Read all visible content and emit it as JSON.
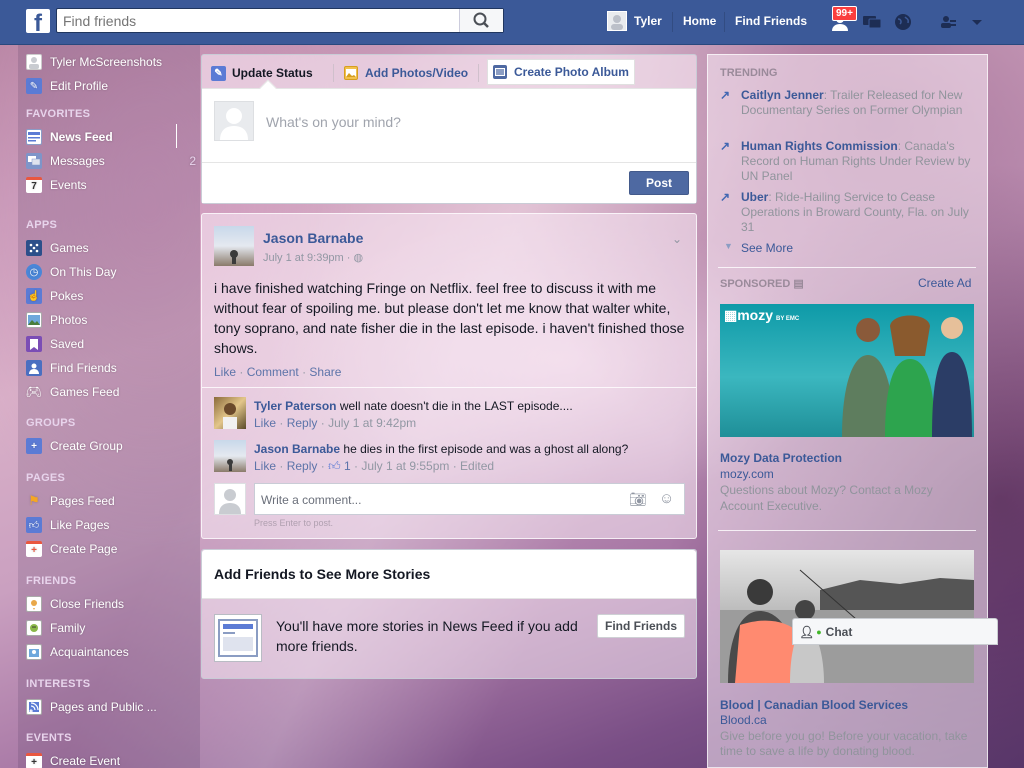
{
  "topbar": {
    "logo": "f",
    "search_placeholder": "Find friends",
    "user_name": "Tyler",
    "home": "Home",
    "find_friends": "Find Friends",
    "notif_badge": "99+"
  },
  "sidebar": {
    "profile_name": "Tyler McScreenshots",
    "edit_profile": "Edit Profile",
    "favorites_heading": "FAVORITES",
    "favorites": [
      {
        "label": "News Feed"
      },
      {
        "label": "Messages",
        "count": "2"
      },
      {
        "label": "Events",
        "icon_text": "7"
      }
    ],
    "apps_heading": "APPS",
    "apps": [
      "Games",
      "On This Day",
      "Pokes",
      "Photos",
      "Saved",
      "Find Friends",
      "Games Feed"
    ],
    "groups_heading": "GROUPS",
    "groups": [
      "Create Group"
    ],
    "pages_heading": "PAGES",
    "pages": [
      "Pages Feed",
      "Like Pages",
      "Create Page"
    ],
    "friends_heading": "FRIENDS",
    "friends": [
      "Close Friends",
      "Family",
      "Acquaintances"
    ],
    "interests_heading": "INTERESTS",
    "interests": [
      "Pages and Public ..."
    ],
    "events_heading": "EVENTS",
    "events": [
      "Create Event"
    ]
  },
  "composer": {
    "tabs": [
      "Update Status",
      "Add Photos/Video",
      "Create Photo Album"
    ],
    "placeholder": "What's on your mind?",
    "post_button": "Post"
  },
  "post": {
    "author": "Jason Barnabe",
    "time": "July 1 at 9:39pm",
    "dot": "·",
    "text": "i have finished watching Fringe on Netflix. feel free to discuss it with me without fear of spoiling me. but please don't let me know that walter white, tony soprano, and nate fisher die in the last episode. i haven't finished those shows.",
    "actions": [
      "Like",
      "Comment",
      "Share"
    ],
    "comments": [
      {
        "author": "Tyler Paterson",
        "text": "well nate doesn't die in the LAST episode....",
        "like": "Like",
        "reply": "Reply",
        "meta": "· July 1 at 9:42pm"
      },
      {
        "author": "Jason Barnabe",
        "text": "he dies in the first episode and was a ghost all along?",
        "like": "Like",
        "reply": "Reply",
        "likes": "1",
        "meta": "· July 1 at 9:55pm · Edited"
      }
    ],
    "comment_placeholder": "Write a comment...",
    "comment_hint": "Press Enter to post."
  },
  "add_friends": {
    "title": "Add Friends to See More Stories",
    "text": "You'll have more stories in News Feed if you add more friends.",
    "button": "Find Friends"
  },
  "trending": {
    "heading": "TRENDING",
    "items": [
      {
        "topic": "Caitlyn Jenner",
        "desc": ": Trailer Released for New Documentary Series on Former Olympian"
      },
      {
        "topic": "Human Rights Commission",
        "desc": ": Canada's Record on Human Rights Under Review by UN Panel"
      },
      {
        "topic": "Uber",
        "desc": ": Ride-Hailing Service to Cease Operations in Broward County, Fla. on July 31"
      }
    ],
    "see_more": "See More"
  },
  "sponsored": {
    "heading": "SPONSORED",
    "create_ad": "Create Ad",
    "ads": [
      {
        "brand": "mozy",
        "brand_sub": "BY EMC",
        "title": "Mozy Data Protection",
        "domain": "mozy.com",
        "desc": "Questions about Mozy? Contact a Mozy Account Executive."
      },
      {
        "title": "Blood | Canadian Blood Services",
        "domain": "Blood.ca",
        "desc": "Give before you go! Before your vacation, take time to save a life by donating blood."
      }
    ]
  },
  "chat": {
    "label": "Chat"
  },
  "colors": {
    "brand": "#3b5998",
    "link": "#3b5998",
    "button": "#4e69a2",
    "badge": "#fa3e3e",
    "online": "#42b72a"
  }
}
